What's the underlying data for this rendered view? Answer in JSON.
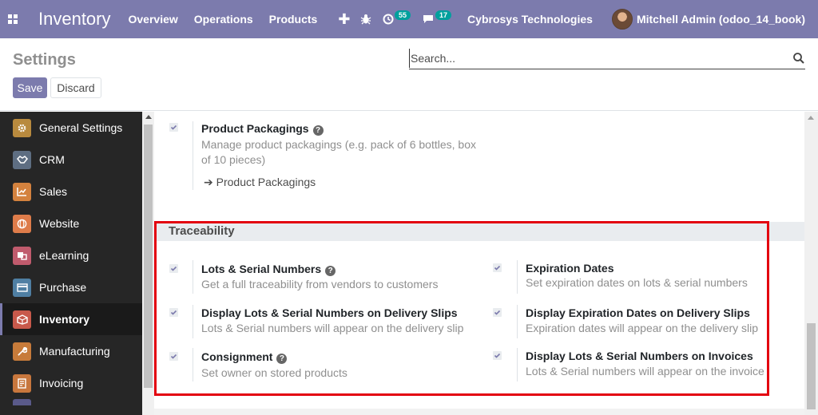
{
  "topbar": {
    "app_name": "Inventory",
    "menu": [
      "Overview",
      "Operations",
      "Products"
    ],
    "activity_count": "55",
    "message_count": "17",
    "company": "Cybrosys Technologies",
    "user": "Mitchell Admin (odoo_14_book)",
    "accent": "#7c7bad"
  },
  "control": {
    "title": "Settings",
    "search_placeholder": "Search...",
    "save_label": "Save",
    "discard_label": "Discard"
  },
  "sidebar": {
    "items": [
      {
        "label": "General Settings",
        "icon": "gear-icon",
        "color": "#b88a3e"
      },
      {
        "label": "CRM",
        "icon": "handshake-icon",
        "color": "#5e6e82"
      },
      {
        "label": "Sales",
        "icon": "chart-icon",
        "color": "#d4823e"
      },
      {
        "label": "Website",
        "icon": "globe-icon",
        "color": "#de7c4a"
      },
      {
        "label": "eLearning",
        "icon": "elearning-icon",
        "color": "#c05b6d"
      },
      {
        "label": "Purchase",
        "icon": "card-icon",
        "color": "#4f7fa3"
      },
      {
        "label": "Inventory",
        "icon": "box-icon",
        "color": "#c8594b",
        "active": true
      },
      {
        "label": "Manufacturing",
        "icon": "wrench-icon",
        "color": "#c77b3a"
      },
      {
        "label": "Invoicing",
        "icon": "invoice-icon",
        "color": "#c8773d"
      }
    ]
  },
  "packaging": {
    "title": "Product Packagings",
    "desc_line1": "Manage product packagings (e.g. pack of 6 bottles, box",
    "desc_line2": "of 10 pieces)",
    "link": "Product Packagings"
  },
  "traceability": {
    "header": "Traceability",
    "settings": [
      {
        "title": "Lots & Serial Numbers",
        "desc": "Get a full traceability from vendors to customers",
        "help": true
      },
      {
        "title": "Expiration Dates",
        "desc": "Set expiration dates on lots & serial numbers",
        "help": false
      },
      {
        "title": "Display Lots & Serial Numbers on Delivery Slips",
        "desc": "Lots & Serial numbers will appear on the delivery slip",
        "help": false
      },
      {
        "title": "Display Expiration Dates on Delivery Slips",
        "desc": "Expiration dates will appear on the delivery slip",
        "help": false
      },
      {
        "title": "Consignment",
        "desc": "Set owner on stored products",
        "help": true
      },
      {
        "title": "Display Lots & Serial Numbers on Invoices",
        "desc": "Lots & Serial numbers will appear on the invoice",
        "help": false
      }
    ]
  }
}
